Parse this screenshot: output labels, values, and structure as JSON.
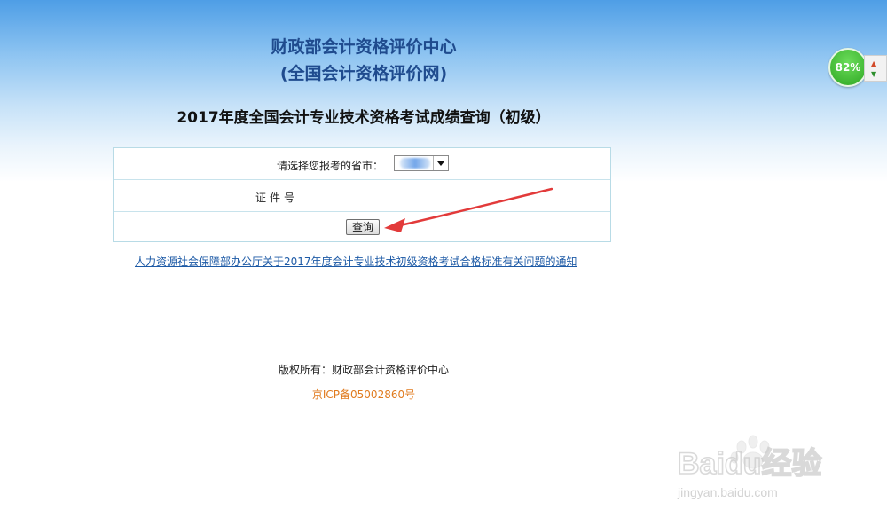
{
  "header": {
    "org_name": "财政部会计资格评价中心",
    "site_name": "(全国会计资格评价网)",
    "page_heading": "2017年度全国会计专业技术资格考试成绩查询（初级）"
  },
  "form": {
    "province_label": "请选择您报考的省市：",
    "id_label": "证件号",
    "id_value": "",
    "query_button_label": "查询"
  },
  "notice_link": "人力资源社会保障部办公厅关于2017年度会计专业技术初级资格考试合格标准有关问题的通知",
  "footer": {
    "copyright": "版权所有：财政部会计资格评价中心",
    "icp": "京ICP备05002860号"
  },
  "speed_widget": {
    "percent": "82%",
    "up_icon": "arrow-up-icon",
    "down_icon": "arrow-down-icon"
  },
  "watermark": {
    "brand": "Baidu经验",
    "url": "jingyan.baidu.com"
  },
  "colors": {
    "title_blue": "#1f4b8e",
    "link_blue": "#1d5aa6",
    "icp_orange": "#e07b1f",
    "annotation_red": "#e23a3a",
    "widget_green": "#2ea723"
  }
}
